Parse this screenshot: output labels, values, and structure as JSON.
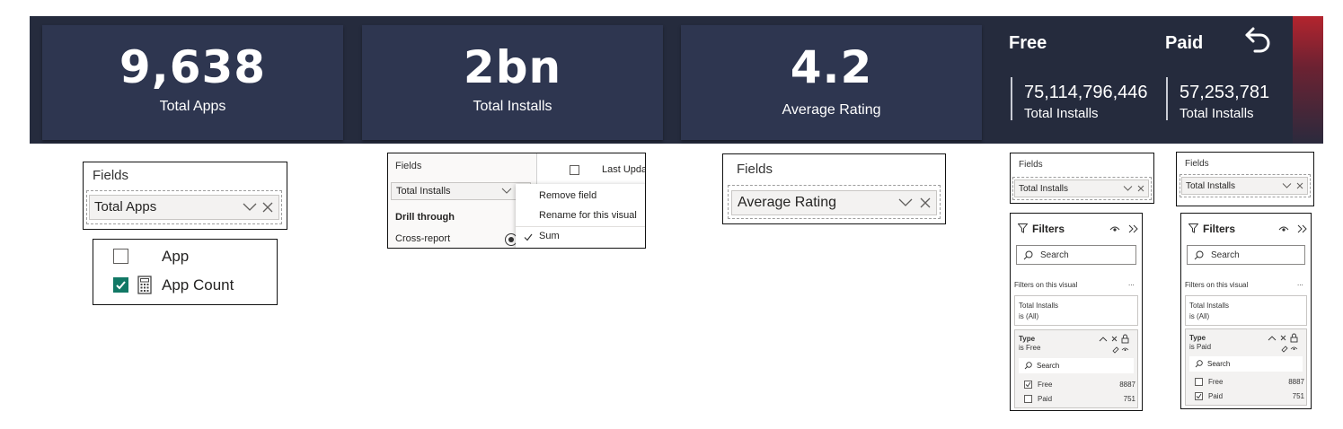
{
  "kpi": {
    "total_apps": {
      "value": "9,638",
      "label": "Total Apps"
    },
    "total_installs": {
      "value": "2bn",
      "label": "Total Installs"
    },
    "avg_rating": {
      "value": "4.2",
      "label": "Average Rating"
    },
    "split": {
      "free": {
        "title": "Free",
        "value": "75,114,796,446",
        "label": "Total Installs"
      },
      "paid": {
        "title": "Paid",
        "value": "57,253,781",
        "label": "Total Installs"
      }
    }
  },
  "fields1": {
    "header": "Fields",
    "field": "Total Apps"
  },
  "appfields": {
    "items": [
      {
        "label": "App",
        "checked": false
      },
      {
        "label": "App Count",
        "checked": true
      }
    ]
  },
  "fields2": {
    "header": "Fields",
    "field": "Total Installs",
    "drill_through": "Drill through",
    "cross_report": "Cross-report",
    "last_updated": "Last Upda",
    "menu": [
      "Remove field",
      "Rename for this visual",
      "Sum"
    ]
  },
  "fields3": {
    "header": "Fields",
    "field": "Average Rating"
  },
  "fields4": {
    "header": "Fields",
    "field": "Total Installs"
  },
  "fields5": {
    "header": "Fields",
    "field": "Total Installs"
  },
  "filters_free": {
    "title": "Filters",
    "search": "Search",
    "section": "Filters on this visual",
    "card1_title": "Total Installs",
    "card1_sub": "is (All)",
    "type_title": "Type",
    "type_sub": "is Free",
    "inner_search": "Search",
    "options": [
      {
        "label": "Free",
        "count": "8887",
        "checked": true
      },
      {
        "label": "Paid",
        "count": "751",
        "checked": false
      }
    ]
  },
  "filters_paid": {
    "title": "Filters",
    "search": "Search",
    "section": "Filters on this visual",
    "card1_title": "Total Installs",
    "card1_sub": "is (All)",
    "type_title": "Type",
    "type_sub": "is Paid",
    "inner_search": "Search",
    "options": [
      {
        "label": "Free",
        "count": "8887",
        "checked": false
      },
      {
        "label": "Paid",
        "count": "751",
        "checked": true
      }
    ]
  },
  "more": "...",
  "colors": {
    "banner": "#252b3d",
    "card": "#2e3650",
    "check": "#117865"
  }
}
